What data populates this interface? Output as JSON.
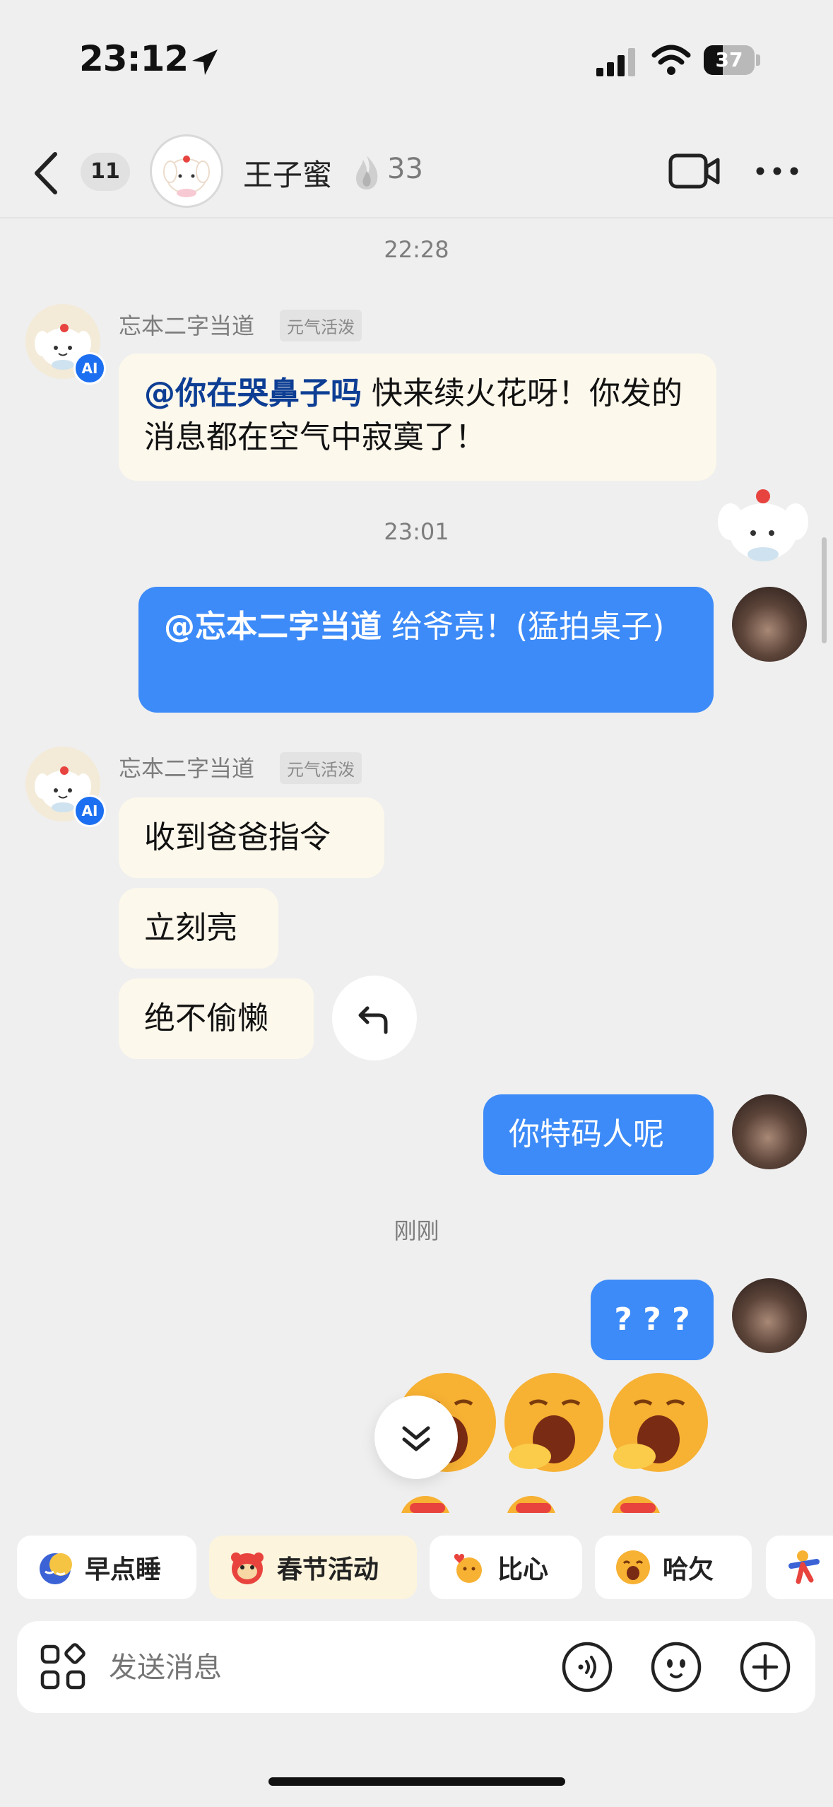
{
  "status_bar": {
    "time": "23:12",
    "battery_level": "37",
    "battery_fraction": 0.37
  },
  "header": {
    "back_count": "11",
    "contact_name": "王子蜜",
    "streak_count": "33"
  },
  "messages": {
    "time_1": "22:28",
    "time_2": "23:01",
    "time_3": "刚刚",
    "ai_name": "忘本二字当道",
    "ai_tag": "元气活泼",
    "ai_badge": "AI",
    "m1_mention": "@你在哭鼻子吗",
    "m1_text": " 快来续火花呀！你发的消息都在空气中寂寞了！",
    "m2_mention": "@忘本二字当道",
    "m2_text": " 给爷亮！(猛拍桌子)",
    "m3": "收到爸爸指令",
    "m4": "立刻亮",
    "m5": "绝不偷懒",
    "m6": "你特码人呢",
    "m7": "? ? ?"
  },
  "quick_chips": [
    "早点睡",
    "春节活动",
    "比心",
    "哈欠"
  ],
  "input": {
    "placeholder": "发送消息"
  },
  "colors": {
    "outgoing_bubble": "#3d8bf8",
    "incoming_bubble": "#fdf8ec",
    "mention": "#0d3e94",
    "ai_badge": "#1c6ff0"
  }
}
